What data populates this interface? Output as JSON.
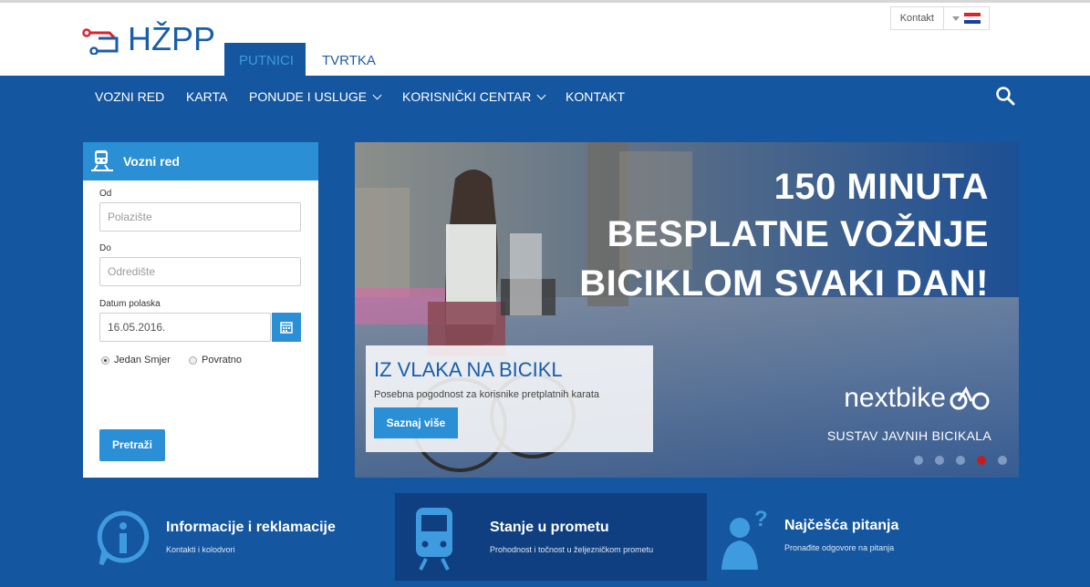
{
  "logo": {
    "text": "HŽPP"
  },
  "tabs": [
    {
      "label": "PUTNICI"
    },
    {
      "label": "TVRTKA"
    }
  ],
  "utility": {
    "contact_label": "Kontakt"
  },
  "nav": {
    "items": [
      {
        "label": "VOZNI RED"
      },
      {
        "label": "KARTA"
      },
      {
        "label": "PONUDE I USLUGE"
      },
      {
        "label": "KORISNIČKI CENTAR"
      },
      {
        "label": "KONTAKT"
      }
    ]
  },
  "timetable": {
    "title": "Vozni red",
    "from_label": "Od",
    "from_placeholder": "Polazište",
    "to_label": "Do",
    "to_placeholder": "Odredište",
    "date_label": "Datum polaska",
    "date_value": "16.05.2016.",
    "one_way_label": "Jedan Smjer",
    "return_label": "Povratno",
    "search_label": "Pretraži"
  },
  "banner": {
    "headline": [
      "150 MINUTA",
      "BESPLATNE VOŽNJE",
      "BICIKLOM SVAKI DAN!"
    ],
    "brand": "nextbike",
    "brand_sub": "SUSTAV JAVNIH BICIKALA",
    "caption_title": "IZ VLAKA NA BICIKL",
    "caption_sub": "Posebna pogodnost za korisnike pretplatnih karata",
    "caption_button": "Saznaj više",
    "slide_count": 5,
    "active_slide": 4
  },
  "tiles": [
    {
      "title": "Informacije i reklamacije",
      "sub": "Kontakti i kolodvori",
      "icon": "info-icon"
    },
    {
      "title": "Stanje u prometu",
      "sub": "Prohodnost i točnost u željezničkom prometu",
      "icon": "train-icon"
    },
    {
      "title": "Najčešća pitanja",
      "sub": "Pronađite odgovore na pitanja",
      "icon": "question-person-icon"
    }
  ],
  "colors": {
    "brand_blue": "#1456a0",
    "accent_blue": "#2b8fd6",
    "active_dot": "#c11f1f"
  }
}
